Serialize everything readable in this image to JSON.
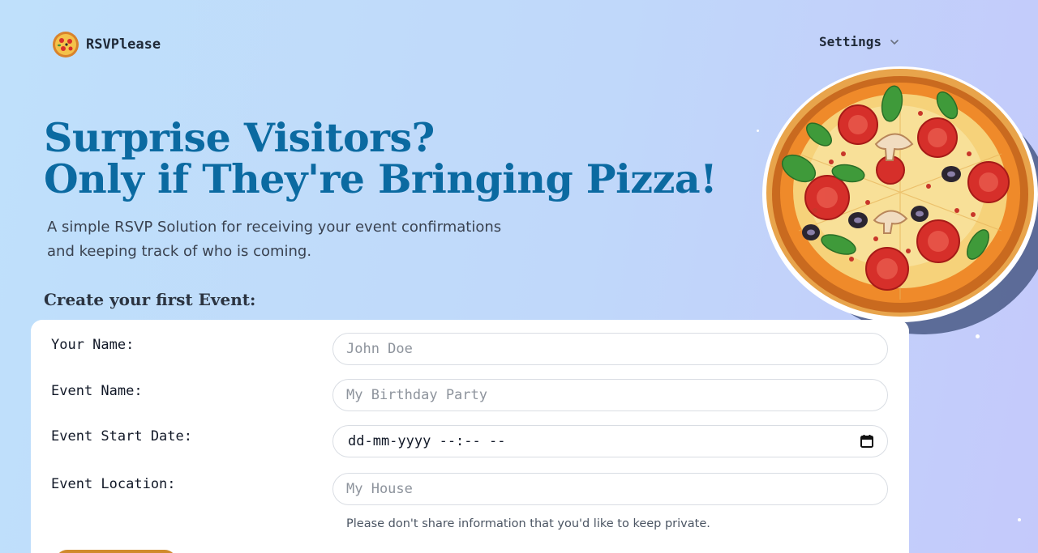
{
  "header": {
    "brand": "RSVPlease",
    "settings_label": "Settings"
  },
  "hero": {
    "title_line1": "Surprise Visitors?",
    "title_line2": "Only if They're Bringing Pizza!",
    "subtitle": "A simple RSVP Solution for receiving your event confirmations and keeping track of who is coming."
  },
  "form": {
    "section_title": "Create your first Event:",
    "your_name": {
      "label": "Your Name:",
      "placeholder": "John Doe"
    },
    "event_name": {
      "label": "Event Name:",
      "placeholder": "My Birthday Party"
    },
    "start_date": {
      "label": "Event Start Date:",
      "value": "dd-mm-yyyy --:-- --"
    },
    "location": {
      "label": "Event Location:",
      "placeholder": "My House"
    },
    "privacy_hint": "Please don't share information that you'd like to keep private."
  },
  "colors": {
    "title": "#0b6aa1",
    "accent_button": "#d08a2c"
  },
  "icons": [
    "pizza-logo-icon",
    "chevron-down-icon",
    "calendar-icon",
    "pizza-illustration"
  ]
}
